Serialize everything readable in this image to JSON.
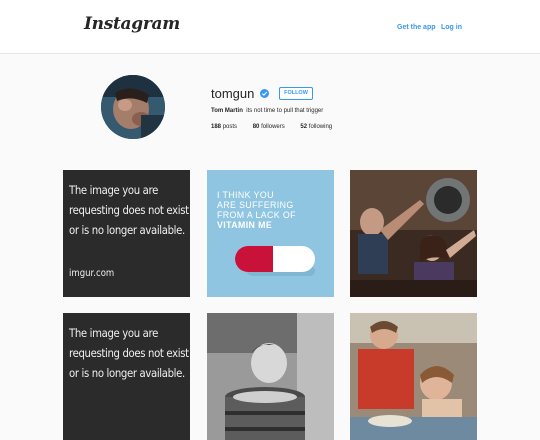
{
  "header": {
    "logo_text": "Instagram",
    "get_app_label": "Get the app",
    "login_label": "Log in"
  },
  "profile": {
    "username": "tomgun",
    "follow_label": "FOLLOW",
    "full_name": "Tom Martin",
    "bio_text": "its not time to pull that trigger",
    "posts_count": "188",
    "posts_label": "posts",
    "followers_count": "80",
    "followers_label": "followers",
    "following_count": "52",
    "following_label": "following"
  },
  "grid": {
    "imgur_line1": "The image you are",
    "imgur_line2": "requesting does not exist",
    "imgur_line3": "or is no longer available.",
    "imgur_site": "imgur.com",
    "vitamin_line1": "I THINK YOU",
    "vitamin_line2": "ARE SUFFERING",
    "vitamin_line3": "FROM A LACK OF",
    "vitamin_line4": "VITAMIN ME"
  },
  "colors": {
    "accent": "#3897f0",
    "background": "#fafafa",
    "vitamin_bg": "#8fc5e0",
    "pill_red": "#c8123a"
  }
}
